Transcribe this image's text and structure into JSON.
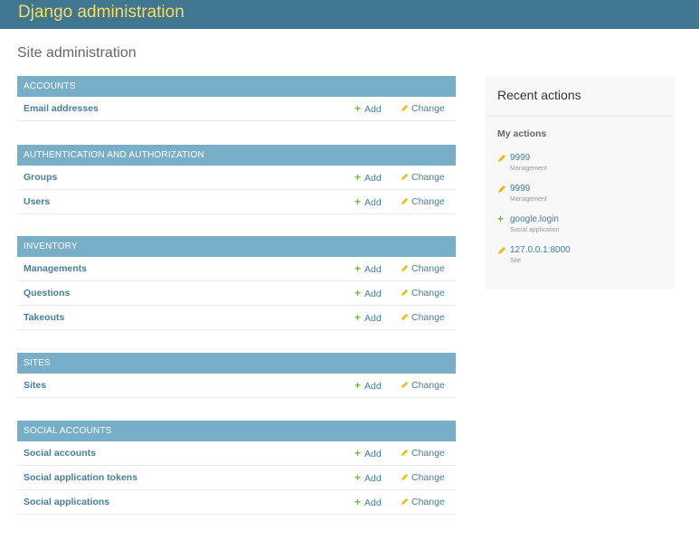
{
  "header": {
    "branding": "Django administration"
  },
  "page": {
    "title": "Site administration"
  },
  "labels": {
    "add": "Add",
    "change": "Change"
  },
  "colors": {
    "header_bg": "#417690",
    "branding": "#f5dd5d",
    "caption_bg": "#79aec8",
    "link": "#447e9b",
    "add_icon": "#70bf2b",
    "change_icon": "#efb80b"
  },
  "modules": [
    {
      "caption": "ACCOUNTS",
      "models": [
        {
          "name": "Email addresses"
        }
      ]
    },
    {
      "caption": "AUTHENTICATION AND AUTHORIZATION",
      "models": [
        {
          "name": "Groups"
        },
        {
          "name": "Users"
        }
      ]
    },
    {
      "caption": "INVENTORY",
      "models": [
        {
          "name": "Managements"
        },
        {
          "name": "Questions"
        },
        {
          "name": "Takeouts"
        }
      ]
    },
    {
      "caption": "SITES",
      "models": [
        {
          "name": "Sites"
        }
      ]
    },
    {
      "caption": "SOCIAL ACCOUNTS",
      "models": [
        {
          "name": "Social accounts"
        },
        {
          "name": "Social application tokens"
        },
        {
          "name": "Social applications"
        }
      ]
    }
  ],
  "recent": {
    "title": "Recent actions",
    "my_actions_title": "My actions",
    "actions": [
      {
        "icon": "pencil-icon",
        "label": "9999",
        "type": "Management"
      },
      {
        "icon": "pencil-icon",
        "label": "9999",
        "type": "Management"
      },
      {
        "icon": "plus-icon",
        "label": "google.login",
        "type": "Social application"
      },
      {
        "icon": "pencil-icon",
        "label": "127.0.0.1:8000",
        "type": "Site"
      }
    ]
  }
}
